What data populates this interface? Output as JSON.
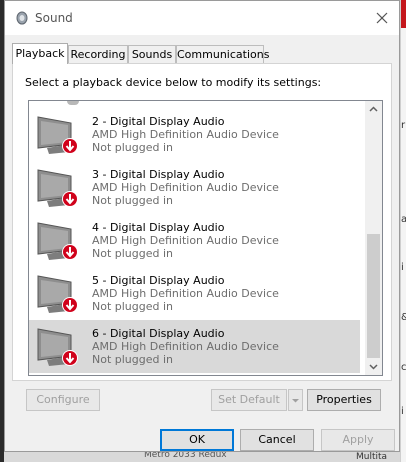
{
  "window": {
    "title": "Sound"
  },
  "tabs": [
    {
      "label": "Playback",
      "active": true
    },
    {
      "label": "Recording",
      "active": false
    },
    {
      "label": "Sounds",
      "active": false
    },
    {
      "label": "Communications",
      "active": false
    }
  ],
  "instruction": "Select a playback device below to modify its settings:",
  "devices": [
    {
      "name": "2 - Digital Display Audio",
      "manufacturer": "AMD High Definition Audio Device",
      "status": "Not plugged in",
      "selected": false
    },
    {
      "name": "3 - Digital Display Audio",
      "manufacturer": "AMD High Definition Audio Device",
      "status": "Not plugged in",
      "selected": false
    },
    {
      "name": "4 - Digital Display Audio",
      "manufacturer": "AMD High Definition Audio Device",
      "status": "Not plugged in",
      "selected": false
    },
    {
      "name": "5 - Digital Display Audio",
      "manufacturer": "AMD High Definition Audio Device",
      "status": "Not plugged in",
      "selected": false
    },
    {
      "name": "6 - Digital Display Audio",
      "manufacturer": "AMD High Definition Audio Device",
      "status": "Not plugged in",
      "selected": true
    }
  ],
  "buttons": {
    "configure": "Configure",
    "set_default": "Set Default",
    "properties": "Properties",
    "ok": "OK",
    "cancel": "Cancel",
    "apply": "Apply"
  },
  "background": {
    "bottom_text": "Metro 2033 Redux",
    "bottom_right_text": "Multita"
  },
  "colors": {
    "status_arrow": "#d0021b",
    "selection": "#d9d9d9",
    "default_button_border": "#0078d7"
  },
  "icons": {
    "window": "speaker-icon",
    "close": "close-icon",
    "device": "monitor-icon",
    "status": "red-down-arrow-icon"
  }
}
